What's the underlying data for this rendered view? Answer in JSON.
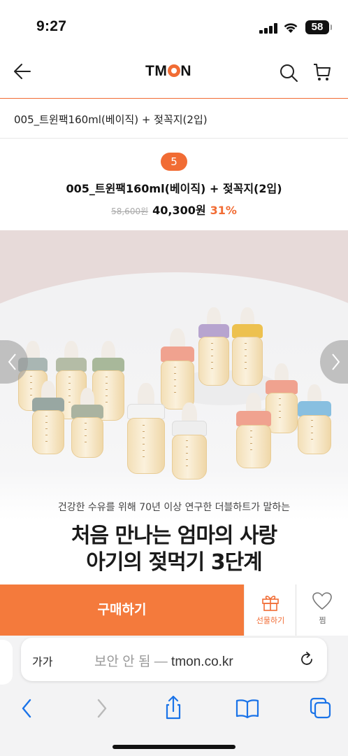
{
  "status_bar": {
    "time": "9:27",
    "battery": "58"
  },
  "header": {
    "logo_text_before": "TM",
    "logo_text_after": "N"
  },
  "option": {
    "selected": "005_트윈팩160ml(베이직) + 젖꼭지(2입)"
  },
  "product": {
    "badge": "5",
    "name": "005_트윈팩160ml(베이직) + 젖꼭지(2입)",
    "original_price": "58,600원",
    "sale_price": "40,300원",
    "discount": "31%"
  },
  "banner": {
    "subtitle": "건강한 수유를 위해 70년 이상 연구한 더블하트가 말하는",
    "headline_1": "처음 만나는 엄마의 사랑",
    "headline_2": "아기의 젖먹기 3단계"
  },
  "actions": {
    "buy": "구매하기",
    "gift": "선물하기",
    "wish": "찜"
  },
  "safari": {
    "aa": "가가",
    "url_prefix": "보안 안 됨 — ",
    "url_domain": "tmon.co.kr"
  },
  "colors": {
    "accent": "#f16c34",
    "buy_button": "#f47a3c"
  }
}
